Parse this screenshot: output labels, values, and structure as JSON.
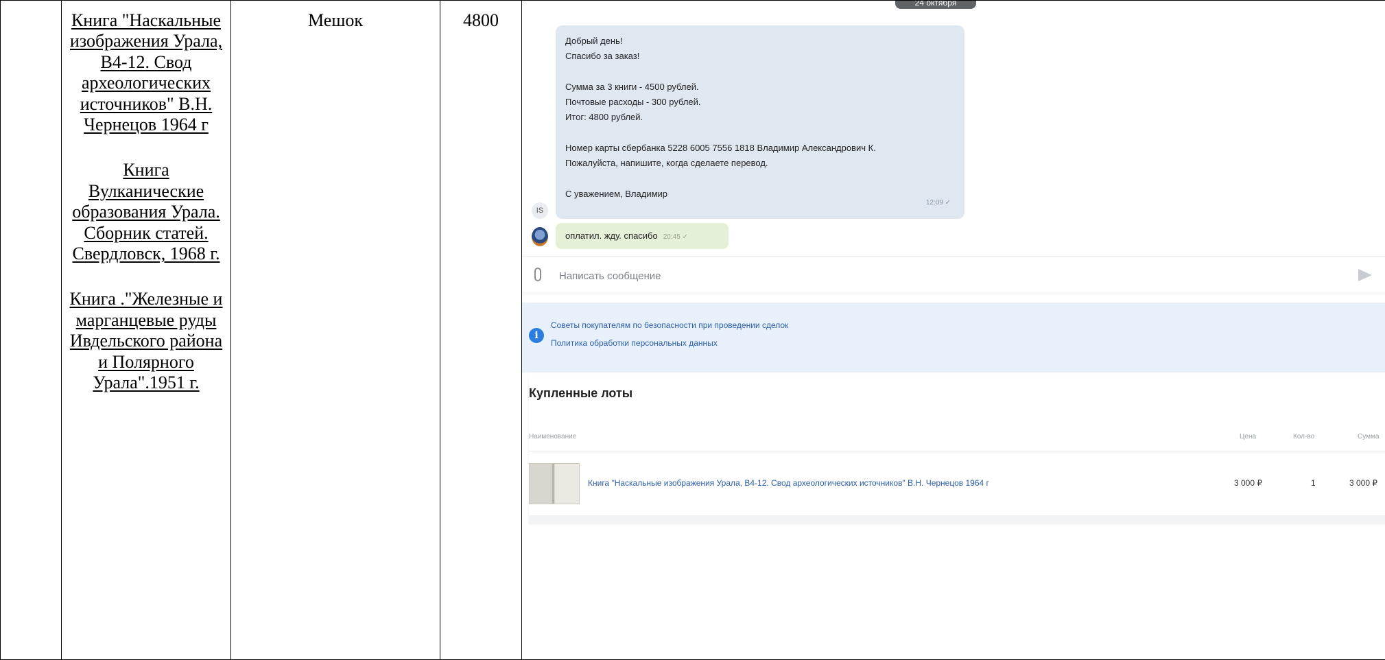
{
  "table": {
    "titles": [
      "Книга \"Наскальные изображения Урала, В4-12. Свод археологических источников\" В.Н. Чернецов 1964 г",
      "Книга Вулканические образования Урала. Сборник статей. Свердловск, 1968 г.",
      "Книга .\"Железные и марганцевые руды Ивдельского района и Полярного Урала\".1951 г."
    ],
    "packaging": "Мешок",
    "total": "4800"
  },
  "chat": {
    "date_chip": "24 октября",
    "seller_message": "Добрый день!\nСпасибо за заказ!\n\nСумма за 3 книги - 4500 рублей.\nПочтовые расходы - 300 рублей.\nИтог: 4800 рублей.\n\nНомер карты сбербанка 5228 6005 7556 1818 Владимир Александрович К.\nПожалуйста, напишите, когда сделаете перевод.\n\nС уважением, Владимир",
    "seller_time": "12:09 ✓",
    "seller_avatar": "IS",
    "buyer_message": "оплатил. жду. спасибо",
    "buyer_time": "20:45 ✓",
    "composer_placeholder": "Написать сообщение",
    "icons": [
      "paperclip-icon",
      "send-icon",
      "info-icon"
    ]
  },
  "notice": {
    "link1": "Советы покупателям по безопасности при проведении сделок",
    "link2": "Политика обработки персональных данных"
  },
  "lots": {
    "title": "Купленные лоты",
    "columns": {
      "name": "Наименование",
      "price": "Цена",
      "qty": "Кол-во",
      "sum": "Сумма"
    },
    "rows": [
      {
        "name": "Книга \"Наскальные изображения Урала, В4-12. Свод археологических источников\" В.Н. Чернецов 1964 г",
        "price": "3 000 ₽",
        "qty": "1",
        "sum": "3 000 ₽"
      }
    ]
  }
}
